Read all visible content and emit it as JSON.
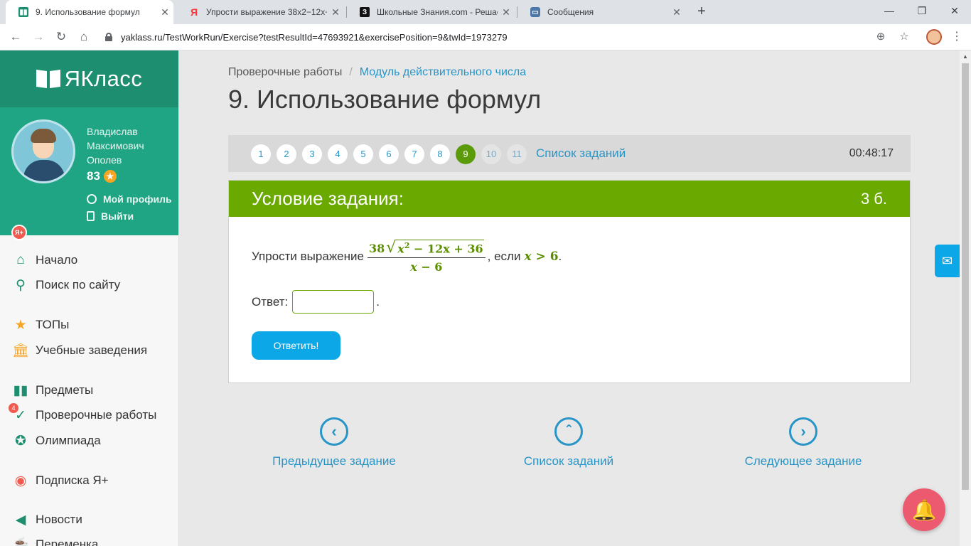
{
  "browser": {
    "tabs": [
      {
        "title": "9. Использование формул",
        "favicon": "yaklass-icon",
        "active": true
      },
      {
        "title": "Упрости выражение 38x2−12x+",
        "favicon": "yandex-icon",
        "active": false
      },
      {
        "title": "Школьные Знания.com - Решае",
        "favicon": "znanija-icon",
        "active": false
      },
      {
        "title": "Сообщения",
        "favicon": "messages-icon",
        "active": false
      }
    ],
    "url": "yaklass.ru/TestWorkRun/Exercise?testResultId=47693921&exercisePosition=9&twId=1973279",
    "window_controls": {
      "minimize": "—",
      "restore": "❐",
      "close": "✕"
    }
  },
  "sidebar": {
    "logo": "ЯКласс",
    "user": {
      "name_lines": [
        "Владислав",
        "Максимович",
        "Ополев"
      ],
      "points": "83",
      "badge": "Я+",
      "links": [
        "Мой профиль",
        "Выйти"
      ]
    },
    "nav": [
      {
        "label": "Начало",
        "icon": "home-icon"
      },
      {
        "label": "Поиск по сайту",
        "icon": "search-icon"
      },
      {
        "label": "ТОПы",
        "icon": "star-icon"
      },
      {
        "label": "Учебные заведения",
        "icon": "school-icon"
      },
      {
        "label": "Предметы",
        "icon": "books-icon"
      },
      {
        "label": "Проверочные работы",
        "icon": "check-icon",
        "count": "4"
      },
      {
        "label": "Олимпиада",
        "icon": "medal-icon"
      },
      {
        "label": "Подписка Я+",
        "icon": "subscription-icon"
      },
      {
        "label": "Новости",
        "icon": "megaphone-icon"
      },
      {
        "label": "Переменка",
        "icon": "coffee-icon"
      }
    ]
  },
  "main": {
    "breadcrumb": {
      "root": "Проверочные работы",
      "separator": "/",
      "current": "Модуль действительного числа"
    },
    "title": "9. Использование формул",
    "question_nav": {
      "numbers": [
        "1",
        "2",
        "3",
        "4",
        "5",
        "6",
        "7",
        "8",
        "9",
        "10",
        "11"
      ],
      "active": "9",
      "list_label": "Список заданий",
      "timer": "00:48:17"
    },
    "task": {
      "header": "Условие задания:",
      "points": "3 б.",
      "prompt": "Упрости выражение",
      "fraction": {
        "coef": "38",
        "var": "x",
        "exp": "2",
        "rest": " − 12x + 36",
        "den_var": "x",
        "den_rest": " − 6"
      },
      "condition_prefix": ", если",
      "condition_var": "x",
      "condition_rest": " > 6",
      "condition_suffix": ".",
      "answer_label": "Ответ:",
      "answer_value": "",
      "answer_suffix": ".",
      "submit_label": "Ответить!"
    },
    "bottom_nav": {
      "prev": "Предыдущее задание",
      "list": "Список заданий",
      "next": "Следующее задание"
    }
  },
  "colors": {
    "brand_green": "#1d8f70",
    "task_header_green": "#6aa900",
    "link_blue": "#2795c7",
    "button_blue": "#0ba7e6",
    "bell_pink": "#ec5a6f"
  }
}
